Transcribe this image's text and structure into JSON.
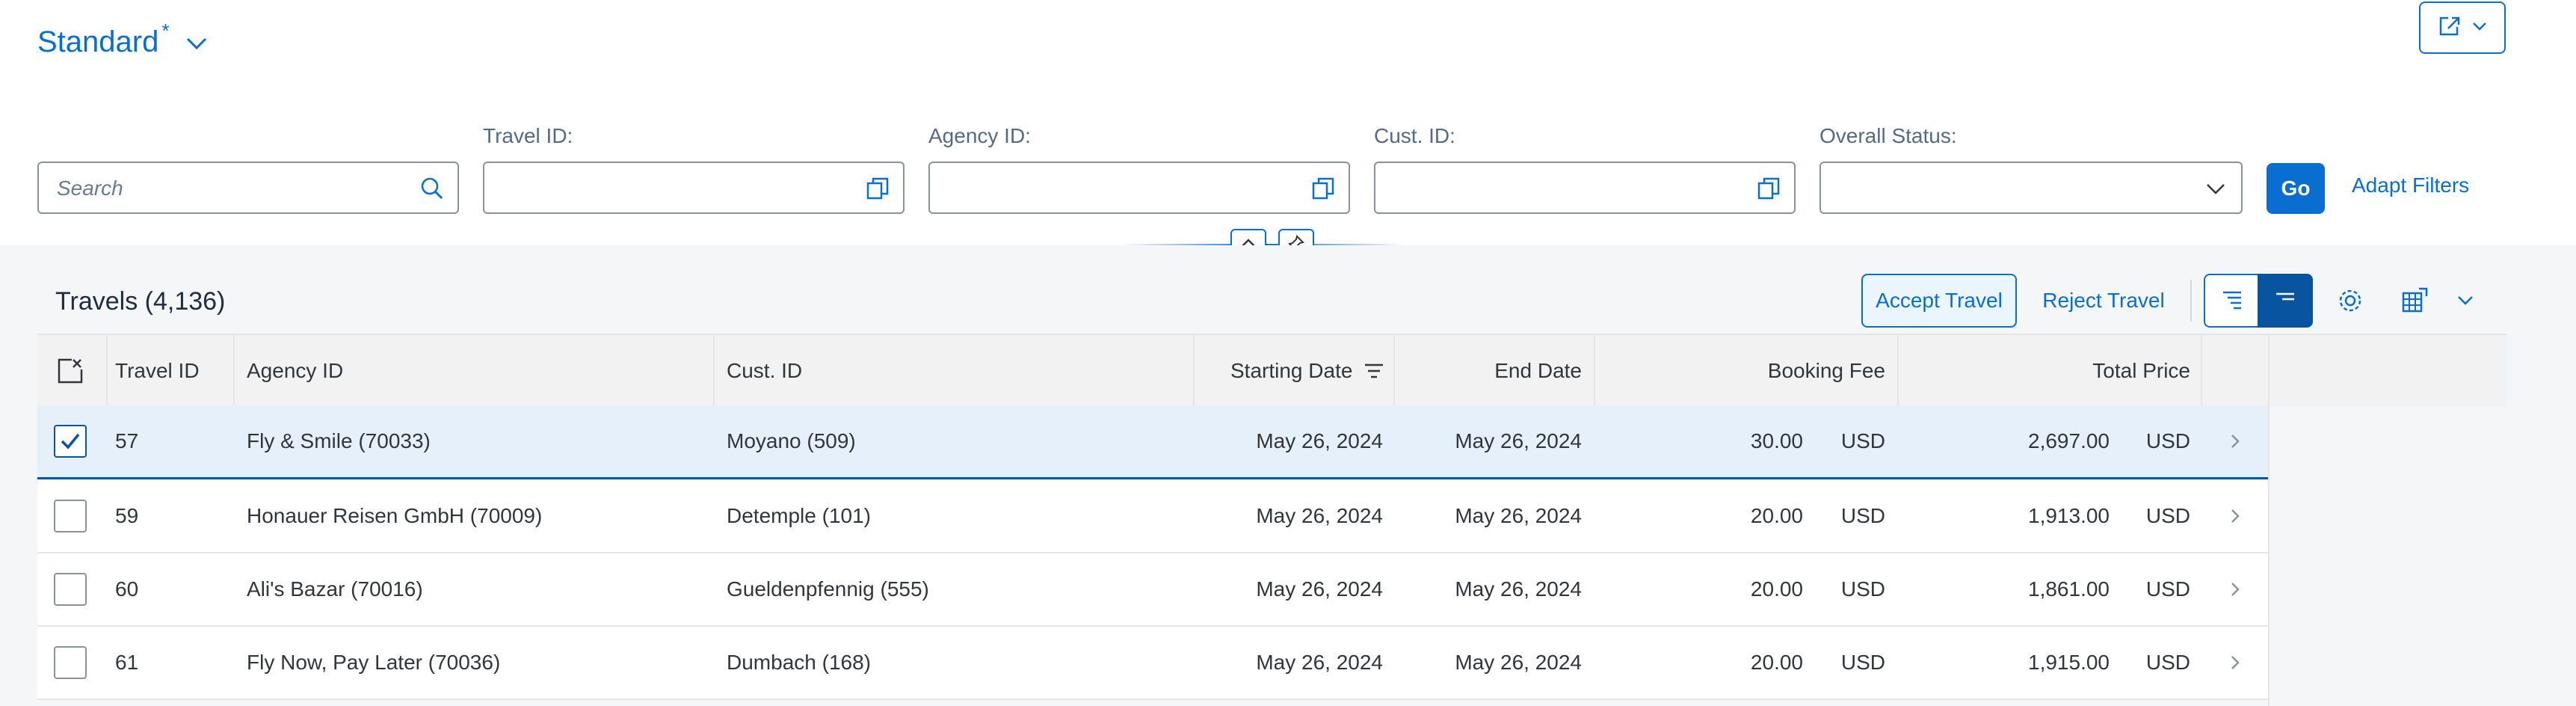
{
  "variant": {
    "title": "Standard",
    "modified_marker": "*"
  },
  "filters": {
    "search_placeholder": "Search",
    "travel_id_label": "Travel ID:",
    "agency_id_label": "Agency ID:",
    "cust_id_label": "Cust. ID:",
    "overall_status_label": "Overall Status:",
    "travel_id_value": "",
    "agency_id_value": "",
    "cust_id_value": "",
    "overall_status_value": "",
    "go_label": "Go",
    "adapt_filters_label": "Adapt Filters"
  },
  "table": {
    "title": "Travels (4,136)",
    "accept_label": "Accept Travel",
    "reject_label": "Reject Travel",
    "columns": {
      "travel_id": "Travel ID",
      "agency_id": "Agency ID",
      "cust_id": "Cust. ID",
      "starting_date": "Starting Date",
      "end_date": "End Date",
      "booking_fee": "Booking Fee",
      "total_price": "Total Price"
    },
    "rows": [
      {
        "travel_id": "57",
        "agency": "Fly & Smile (70033)",
        "customer": "Moyano (509)",
        "start": "May 26, 2024",
        "end": "May 26, 2024",
        "fee": "30.00",
        "fee_cur": "USD",
        "price": "2,697.00",
        "price_cur": "USD",
        "selected": true
      },
      {
        "travel_id": "59",
        "agency": "Honauer Reisen GmbH (70009)",
        "customer": "Detemple (101)",
        "start": "May 26, 2024",
        "end": "May 26, 2024",
        "fee": "20.00",
        "fee_cur": "USD",
        "price": "1,913.00",
        "price_cur": "USD",
        "selected": false
      },
      {
        "travel_id": "60",
        "agency": "Ali's Bazar (70016)",
        "customer": "Gueldenpfennig (555)",
        "start": "May 26, 2024",
        "end": "May 26, 2024",
        "fee": "20.00",
        "fee_cur": "USD",
        "price": "1,861.00",
        "price_cur": "USD",
        "selected": false
      },
      {
        "travel_id": "61",
        "agency": "Fly Now, Pay Later (70036)",
        "customer": "Dumbach (168)",
        "start": "May 26, 2024",
        "end": "May 26, 2024",
        "fee": "20.00",
        "fee_cur": "USD",
        "price": "1,915.00",
        "price_cur": "USD",
        "selected": false
      }
    ]
  },
  "colors": {
    "accent": "#0a6ed1",
    "accent_dark": "#0854a0",
    "selected_row": "#e5f0fa",
    "background": "#f5f6f7"
  },
  "icons": [
    "chevron-down-icon",
    "share-icon",
    "search-icon",
    "value-help-icon",
    "collapse-icon",
    "pin-icon",
    "select-all-icon",
    "sort-descending-icon",
    "table-view-icon",
    "condensed-view-icon",
    "settings-icon",
    "export-icon",
    "navigation-arrow-icon"
  ]
}
